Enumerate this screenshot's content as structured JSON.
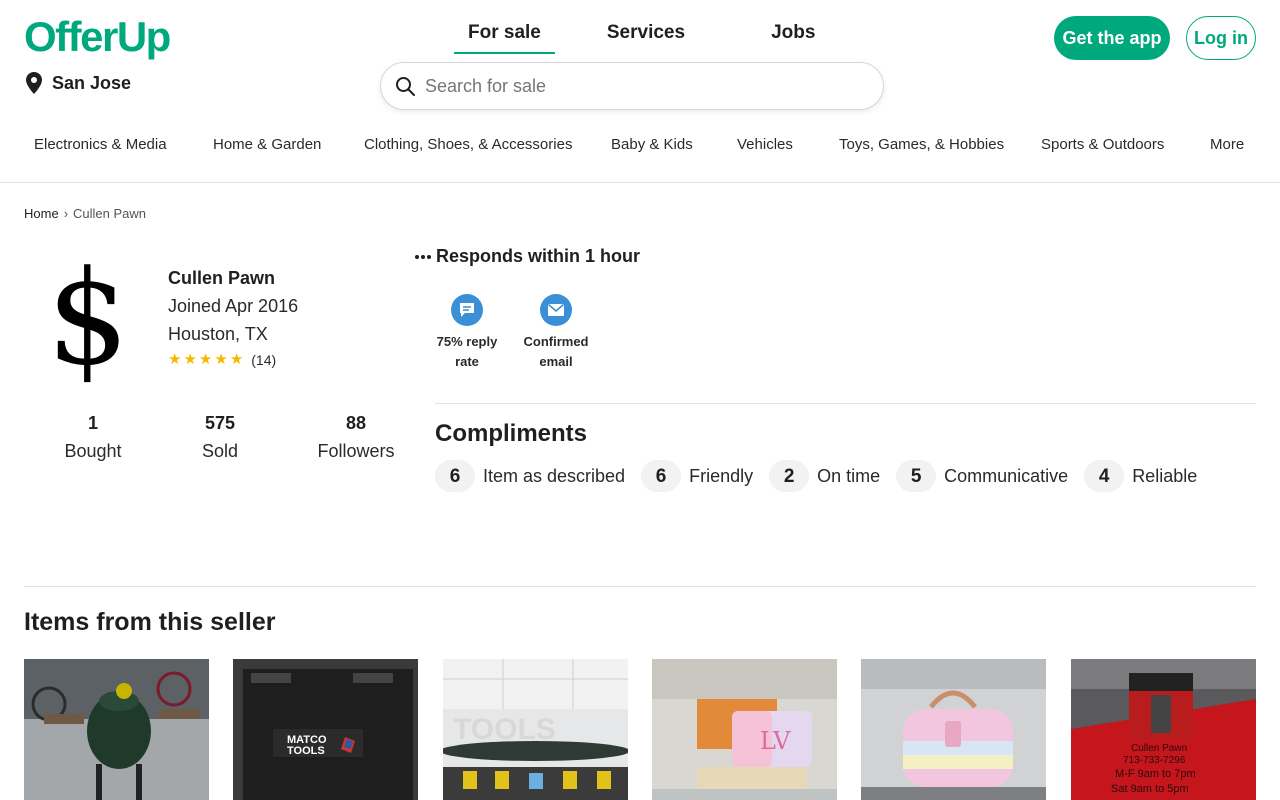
{
  "brand": {
    "logo_text": "OfferUp",
    "accent": "#00a87e"
  },
  "location": {
    "city": "San Jose",
    "icon": "location-pin-icon"
  },
  "nav": {
    "tabs": [
      "For sale",
      "Services",
      "Jobs"
    ],
    "active": "For sale"
  },
  "search": {
    "placeholder": "Search for sale",
    "value": "",
    "icon": "search-icon"
  },
  "header_actions": {
    "get_app": "Get the app",
    "login": "Log in"
  },
  "categories": [
    "Electronics & Media",
    "Home & Garden",
    "Clothing, Shoes, & Accessories",
    "Baby & Kids",
    "Vehicles",
    "Toys, Games, & Hobbies",
    "Sports & Outdoors",
    "More"
  ],
  "breadcrumb": {
    "home": "Home",
    "separator": "›",
    "current": "Cullen Pawn"
  },
  "seller": {
    "avatar_glyph": "$",
    "name": "Cullen Pawn",
    "joined": "Joined Apr 2016",
    "location": "Houston, TX",
    "stars": 5,
    "review_count": "(14)"
  },
  "stats": [
    {
      "value": "1",
      "label": "Bought"
    },
    {
      "value": "575",
      "label": "Sold"
    },
    {
      "value": "88",
      "label": "Followers"
    }
  ],
  "responds": {
    "icon": "more-dots-icon",
    "text": "Responds within 1 hour"
  },
  "badges": [
    {
      "icon": "chat-bubble-icon",
      "line1": "75% reply",
      "line2": "rate"
    },
    {
      "icon": "envelope-icon",
      "line1": "Confirmed",
      "line2": "email"
    }
  ],
  "compliments": {
    "title": "Compliments",
    "items": [
      {
        "count": "6",
        "label": "Item as described"
      },
      {
        "count": "6",
        "label": "Friendly"
      },
      {
        "count": "2",
        "label": "On time"
      },
      {
        "count": "5",
        "label": "Communicative"
      },
      {
        "count": "4",
        "label": "Reliable"
      }
    ]
  },
  "items_section": {
    "title": "Items from this seller",
    "items": [
      {
        "image": "green-egg-grill-photo"
      },
      {
        "image": "matco-tools-case-photo"
      },
      {
        "image": "kayak-wall-display-photo"
      },
      {
        "image": "louis-vuitton-wallet-photo"
      },
      {
        "image": "pastel-handbag-photo"
      },
      {
        "image": "drill-press-box-photo"
      }
    ]
  },
  "colors": {
    "accent": "#00a87e",
    "star": "#f5b800",
    "badge": "#3b8fd6",
    "text": "#1f1f1f"
  }
}
